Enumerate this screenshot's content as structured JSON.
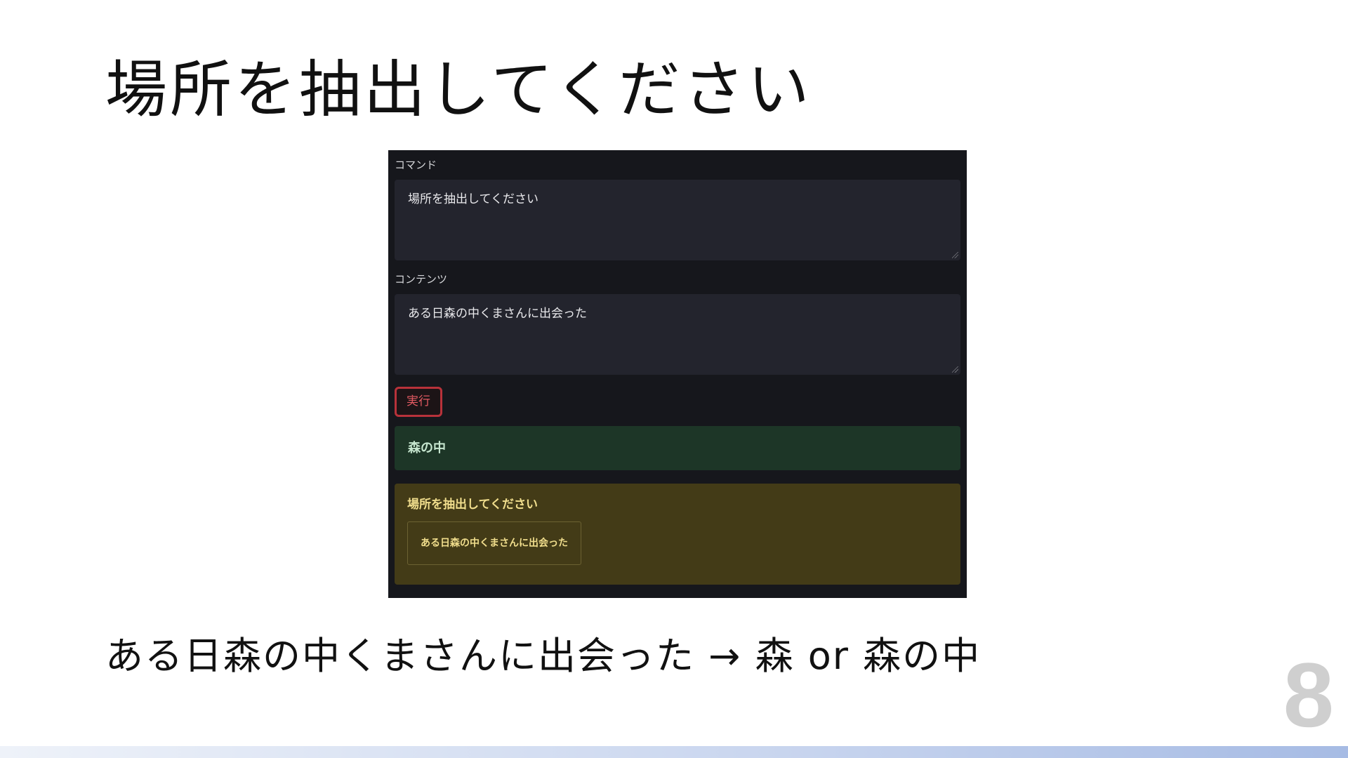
{
  "slide": {
    "title": "場所を抽出してください",
    "caption": "ある日森の中くまさんに出会った → 森 or 森の中",
    "page_number": "8"
  },
  "app": {
    "command_label": "コマンド",
    "command_value": "場所を抽出してください",
    "content_label": "コンテンツ",
    "content_value": "ある日森の中くまさんに出会った",
    "run_button_label": "実行",
    "result_text": "森の中",
    "history": {
      "command": "場所を抽出してください",
      "content": "ある日森の中くまさんに出会った"
    }
  },
  "colors": {
    "panel_bg": "#16171c",
    "textarea_bg": "#23242d",
    "run_button_border": "#b8323a",
    "result_bg": "#1d3627",
    "history_bg": "#433b17"
  }
}
